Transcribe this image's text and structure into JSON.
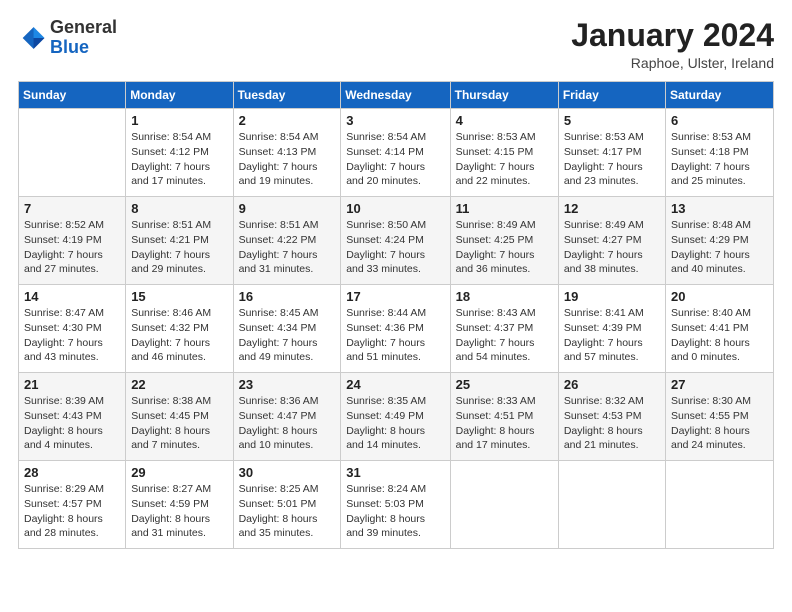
{
  "header": {
    "logo_general": "General",
    "logo_blue": "Blue",
    "month_title": "January 2024",
    "location": "Raphoe, Ulster, Ireland"
  },
  "weekdays": [
    "Sunday",
    "Monday",
    "Tuesday",
    "Wednesday",
    "Thursday",
    "Friday",
    "Saturday"
  ],
  "weeks": [
    [
      {
        "day": "",
        "sunrise": "",
        "sunset": "",
        "daylight": ""
      },
      {
        "day": "1",
        "sunrise": "Sunrise: 8:54 AM",
        "sunset": "Sunset: 4:12 PM",
        "daylight": "Daylight: 7 hours and 17 minutes."
      },
      {
        "day": "2",
        "sunrise": "Sunrise: 8:54 AM",
        "sunset": "Sunset: 4:13 PM",
        "daylight": "Daylight: 7 hours and 19 minutes."
      },
      {
        "day": "3",
        "sunrise": "Sunrise: 8:54 AM",
        "sunset": "Sunset: 4:14 PM",
        "daylight": "Daylight: 7 hours and 20 minutes."
      },
      {
        "day": "4",
        "sunrise": "Sunrise: 8:53 AM",
        "sunset": "Sunset: 4:15 PM",
        "daylight": "Daylight: 7 hours and 22 minutes."
      },
      {
        "day": "5",
        "sunrise": "Sunrise: 8:53 AM",
        "sunset": "Sunset: 4:17 PM",
        "daylight": "Daylight: 7 hours and 23 minutes."
      },
      {
        "day": "6",
        "sunrise": "Sunrise: 8:53 AM",
        "sunset": "Sunset: 4:18 PM",
        "daylight": "Daylight: 7 hours and 25 minutes."
      }
    ],
    [
      {
        "day": "7",
        "sunrise": "Sunrise: 8:52 AM",
        "sunset": "Sunset: 4:19 PM",
        "daylight": "Daylight: 7 hours and 27 minutes."
      },
      {
        "day": "8",
        "sunrise": "Sunrise: 8:51 AM",
        "sunset": "Sunset: 4:21 PM",
        "daylight": "Daylight: 7 hours and 29 minutes."
      },
      {
        "day": "9",
        "sunrise": "Sunrise: 8:51 AM",
        "sunset": "Sunset: 4:22 PM",
        "daylight": "Daylight: 7 hours and 31 minutes."
      },
      {
        "day": "10",
        "sunrise": "Sunrise: 8:50 AM",
        "sunset": "Sunset: 4:24 PM",
        "daylight": "Daylight: 7 hours and 33 minutes."
      },
      {
        "day": "11",
        "sunrise": "Sunrise: 8:49 AM",
        "sunset": "Sunset: 4:25 PM",
        "daylight": "Daylight: 7 hours and 36 minutes."
      },
      {
        "day": "12",
        "sunrise": "Sunrise: 8:49 AM",
        "sunset": "Sunset: 4:27 PM",
        "daylight": "Daylight: 7 hours and 38 minutes."
      },
      {
        "day": "13",
        "sunrise": "Sunrise: 8:48 AM",
        "sunset": "Sunset: 4:29 PM",
        "daylight": "Daylight: 7 hours and 40 minutes."
      }
    ],
    [
      {
        "day": "14",
        "sunrise": "Sunrise: 8:47 AM",
        "sunset": "Sunset: 4:30 PM",
        "daylight": "Daylight: 7 hours and 43 minutes."
      },
      {
        "day": "15",
        "sunrise": "Sunrise: 8:46 AM",
        "sunset": "Sunset: 4:32 PM",
        "daylight": "Daylight: 7 hours and 46 minutes."
      },
      {
        "day": "16",
        "sunrise": "Sunrise: 8:45 AM",
        "sunset": "Sunset: 4:34 PM",
        "daylight": "Daylight: 7 hours and 49 minutes."
      },
      {
        "day": "17",
        "sunrise": "Sunrise: 8:44 AM",
        "sunset": "Sunset: 4:36 PM",
        "daylight": "Daylight: 7 hours and 51 minutes."
      },
      {
        "day": "18",
        "sunrise": "Sunrise: 8:43 AM",
        "sunset": "Sunset: 4:37 PM",
        "daylight": "Daylight: 7 hours and 54 minutes."
      },
      {
        "day": "19",
        "sunrise": "Sunrise: 8:41 AM",
        "sunset": "Sunset: 4:39 PM",
        "daylight": "Daylight: 7 hours and 57 minutes."
      },
      {
        "day": "20",
        "sunrise": "Sunrise: 8:40 AM",
        "sunset": "Sunset: 4:41 PM",
        "daylight": "Daylight: 8 hours and 0 minutes."
      }
    ],
    [
      {
        "day": "21",
        "sunrise": "Sunrise: 8:39 AM",
        "sunset": "Sunset: 4:43 PM",
        "daylight": "Daylight: 8 hours and 4 minutes."
      },
      {
        "day": "22",
        "sunrise": "Sunrise: 8:38 AM",
        "sunset": "Sunset: 4:45 PM",
        "daylight": "Daylight: 8 hours and 7 minutes."
      },
      {
        "day": "23",
        "sunrise": "Sunrise: 8:36 AM",
        "sunset": "Sunset: 4:47 PM",
        "daylight": "Daylight: 8 hours and 10 minutes."
      },
      {
        "day": "24",
        "sunrise": "Sunrise: 8:35 AM",
        "sunset": "Sunset: 4:49 PM",
        "daylight": "Daylight: 8 hours and 14 minutes."
      },
      {
        "day": "25",
        "sunrise": "Sunrise: 8:33 AM",
        "sunset": "Sunset: 4:51 PM",
        "daylight": "Daylight: 8 hours and 17 minutes."
      },
      {
        "day": "26",
        "sunrise": "Sunrise: 8:32 AM",
        "sunset": "Sunset: 4:53 PM",
        "daylight": "Daylight: 8 hours and 21 minutes."
      },
      {
        "day": "27",
        "sunrise": "Sunrise: 8:30 AM",
        "sunset": "Sunset: 4:55 PM",
        "daylight": "Daylight: 8 hours and 24 minutes."
      }
    ],
    [
      {
        "day": "28",
        "sunrise": "Sunrise: 8:29 AM",
        "sunset": "Sunset: 4:57 PM",
        "daylight": "Daylight: 8 hours and 28 minutes."
      },
      {
        "day": "29",
        "sunrise": "Sunrise: 8:27 AM",
        "sunset": "Sunset: 4:59 PM",
        "daylight": "Daylight: 8 hours and 31 minutes."
      },
      {
        "day": "30",
        "sunrise": "Sunrise: 8:25 AM",
        "sunset": "Sunset: 5:01 PM",
        "daylight": "Daylight: 8 hours and 35 minutes."
      },
      {
        "day": "31",
        "sunrise": "Sunrise: 8:24 AM",
        "sunset": "Sunset: 5:03 PM",
        "daylight": "Daylight: 8 hours and 39 minutes."
      },
      {
        "day": "",
        "sunrise": "",
        "sunset": "",
        "daylight": ""
      },
      {
        "day": "",
        "sunrise": "",
        "sunset": "",
        "daylight": ""
      },
      {
        "day": "",
        "sunrise": "",
        "sunset": "",
        "daylight": ""
      }
    ]
  ]
}
